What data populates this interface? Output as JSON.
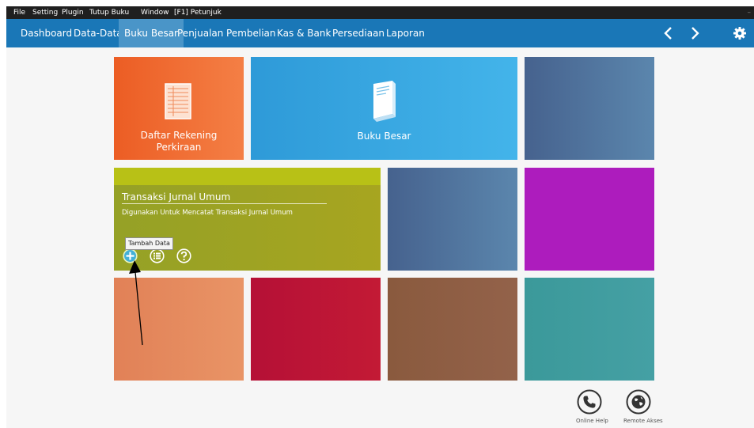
{
  "menubar": {
    "items": [
      "File",
      "Setting",
      "Plugin",
      "Tutup Buku",
      "Window",
      "[F1] Petunjuk"
    ],
    "trailing": "–"
  },
  "nav": {
    "tabs": [
      "Dashboard",
      "Data-Data",
      "Buku Besar",
      "Penjualan",
      "Pembelian",
      "Kas & Bank",
      "Persediaan",
      "Laporan"
    ],
    "active": "Buku Besar",
    "icons": [
      "chevron-left-icon",
      "chevron-right-icon",
      "gear-icon"
    ]
  },
  "tiles": {
    "daftar_rekening": "Daftar Rekening\nPerkiraan",
    "buku_besar": "Buku Besar",
    "jurnal": {
      "title": "Transaksi Jurnal Umum",
      "description": "Digunakan Untuk Mencatat Transaksi Jurnal Umum",
      "tooltip": "Tambah Data",
      "actions": [
        "plus-circle-icon",
        "list-circle-icon",
        "help-circle-icon"
      ]
    }
  },
  "footer": {
    "online_help": "Online Help",
    "remote_akses": "Remote Akses"
  },
  "colors": {
    "menubar": "#1f1f1f",
    "navbar": "#1a77b7",
    "nav_active": "#4a95c8",
    "orange": "#ec5d24",
    "blue": "#2e9ad8",
    "slate": "#46628e",
    "olive": "#95a126",
    "purple": "#ad1cbd",
    "salmon": "#e18157",
    "crimson": "#b51036",
    "brown": "#8a5a3e",
    "teal": "#3b999a"
  }
}
